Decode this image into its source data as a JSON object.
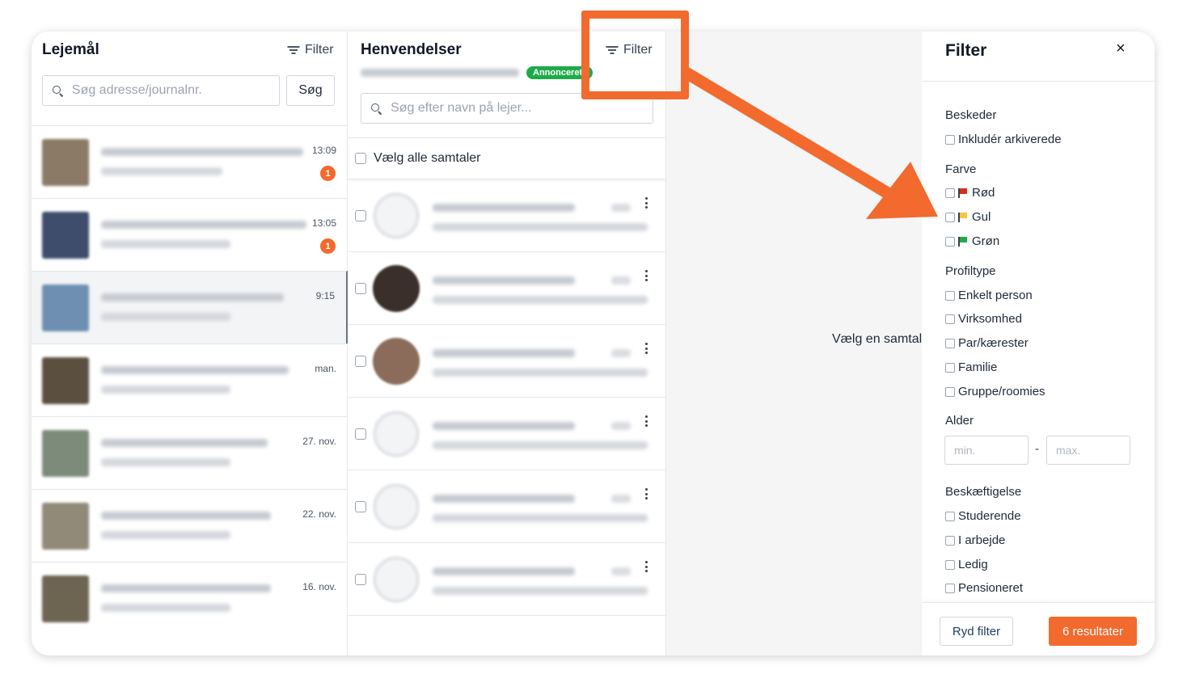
{
  "properties_panel": {
    "title": "Lejemål",
    "filter_label": "Filter",
    "search_placeholder": "Søg adresse/journalnr.",
    "search_button": "Søg",
    "items": [
      {
        "time": "13:09",
        "badge": "1",
        "thumb": "#8a7a66"
      },
      {
        "time": "13:05",
        "badge": "1",
        "thumb": "#3d4d6b"
      },
      {
        "time": "9:15",
        "badge": "",
        "thumb": "#6e8fb2"
      },
      {
        "time": "man.",
        "badge": "",
        "thumb": "#5b5040"
      },
      {
        "time": "27. nov.",
        "badge": "",
        "thumb": "#7d8c7a"
      },
      {
        "time": "22. nov.",
        "badge": "",
        "thumb": "#928a78"
      },
      {
        "time": "16. nov.",
        "badge": "",
        "thumb": "#6d6452"
      }
    ]
  },
  "inquiries_panel": {
    "title": "Henvendelser",
    "status_pill": "Annonceret",
    "filter_label": "Filter",
    "search_placeholder": "Søg efter navn på lejer...",
    "select_all_label": "Vælg alle samtaler",
    "conversations": [
      {
        "avatar": "empty"
      },
      {
        "avatar": "#3a2f2a"
      },
      {
        "avatar": "#8b6b5a"
      },
      {
        "avatar": "empty"
      },
      {
        "avatar": "empty"
      },
      {
        "avatar": "empty"
      }
    ]
  },
  "main": {
    "empty_message": "Vælg en samtale"
  },
  "filter_panel": {
    "title": "Filter",
    "close_label": "×",
    "sections": {
      "messages": {
        "title": "Beskeder",
        "options": [
          "Inkludér arkiverede"
        ]
      },
      "color": {
        "title": "Farve",
        "options": [
          {
            "label": "Rød",
            "color": "#d62c1e"
          },
          {
            "label": "Gul",
            "color": "#f7c63d"
          },
          {
            "label": "Grøn",
            "color": "#1faa4a"
          }
        ]
      },
      "profile_type": {
        "title": "Profiltype",
        "options": [
          "Enkelt person",
          "Virksomhed",
          "Par/kærester",
          "Familie",
          "Gruppe/roomies"
        ]
      },
      "age": {
        "title": "Alder",
        "min_placeholder": "min.",
        "max_placeholder": "max.",
        "separator": "-"
      },
      "occupation": {
        "title": "Beskæftigelse",
        "options": [
          "Studerende",
          "I arbejde",
          "Ledig",
          "Pensioneret"
        ]
      }
    },
    "clear_button": "Ryd filter",
    "results_button": "6 resultater"
  },
  "annotation": {
    "color": "#f26a2e"
  }
}
